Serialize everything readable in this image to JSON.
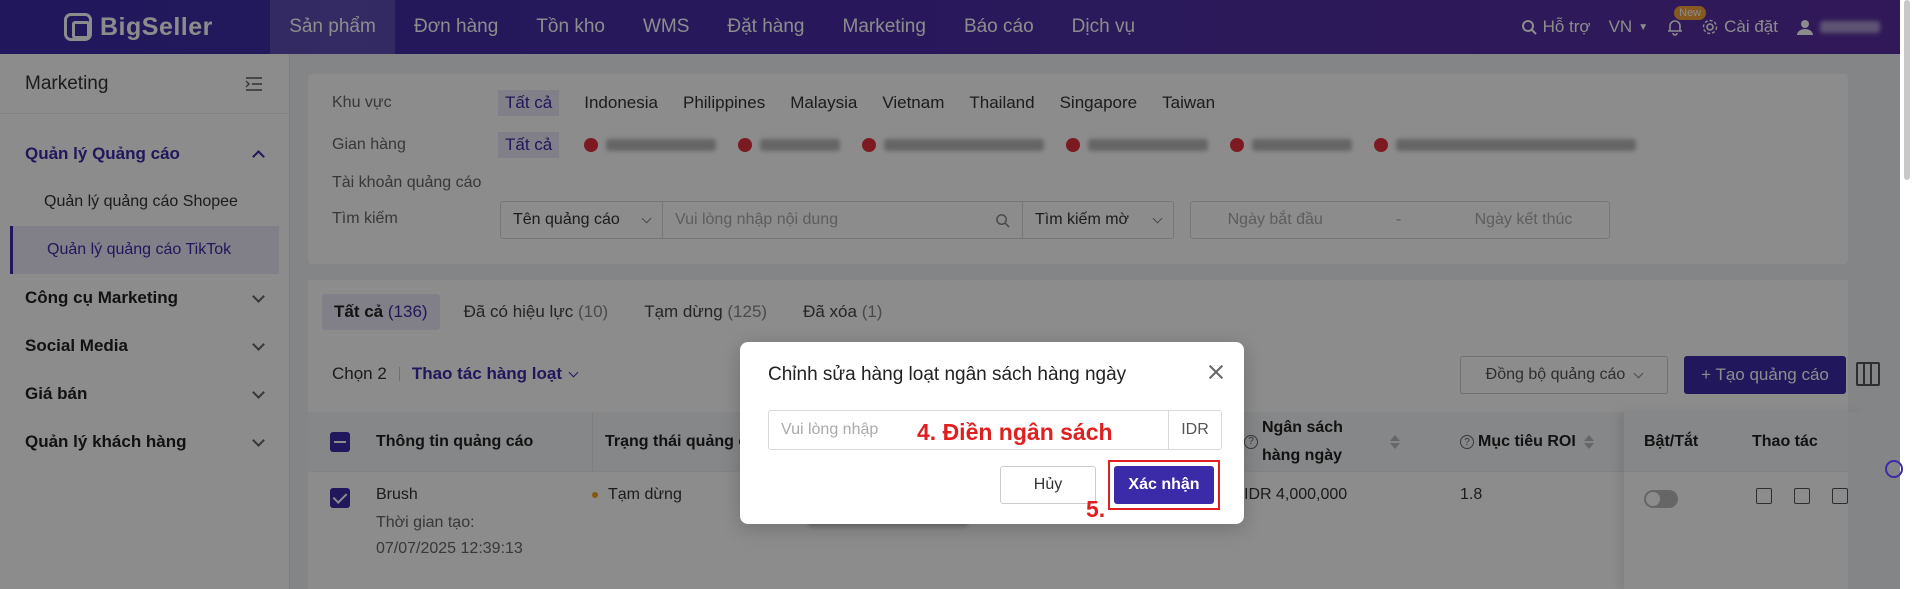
{
  "topnav": {
    "brand": "BigSeller",
    "items": [
      "Sản phẩm",
      "Đơn hàng",
      "Tồn kho",
      "WMS",
      "Đặt hàng",
      "Marketing",
      "Báo cáo",
      "Dịch vụ"
    ],
    "support": "Hỗ trợ",
    "lang": "VN",
    "new_badge": "New",
    "settings": "Cài đặt"
  },
  "sidebar": {
    "title": "Marketing",
    "groups": [
      {
        "label": "Quản lý Quảng cáo",
        "sub": [
          "Quản lý quảng cáo Shopee",
          "Quản lý quảng cáo TikTok"
        ]
      },
      {
        "label": "Công cụ Marketing"
      },
      {
        "label": "Social Media"
      },
      {
        "label": "Giá bán"
      },
      {
        "label": "Quản lý khách hàng"
      }
    ]
  },
  "filters": {
    "region_label": "Khu vực",
    "regions": [
      "Tất cả",
      "Indonesia",
      "Philippines",
      "Malaysia",
      "Vietnam",
      "Thailand",
      "Singapore",
      "Taiwan"
    ],
    "shop_label": "Gian hàng",
    "shop_all": "Tất cả",
    "account_label": "Tài khoản quảng cáo",
    "search_label": "Tìm kiếm",
    "search_field": "Tên quảng cáo",
    "search_placeholder": "Vui lòng nhập nội dung",
    "search_mode": "Tìm kiếm mờ",
    "date_start": "Ngày bắt đầu",
    "date_sep": "-",
    "date_end": "Ngày kết thúc"
  },
  "tabs": [
    {
      "label": "Tất cả",
      "count": "(136)"
    },
    {
      "label": "Đã có hiệu lực",
      "count": "(10)"
    },
    {
      "label": "Tạm dừng",
      "count": "(125)"
    },
    {
      "label": "Đã xóa",
      "count": "(1)"
    }
  ],
  "toolbar": {
    "selected": "Chọn 2",
    "bulk": "Thao tác hàng loạt",
    "sync": "Đồng bộ quảng cáo",
    "create": "+ Tạo quảng cáo"
  },
  "table": {
    "headers": {
      "info": "Thông tin quảng cáo",
      "status": "Trạng thái quảng cáo",
      "budget": "Ngân sách hàng ngày",
      "roi": "Mục tiêu ROI",
      "toggle": "Bật/Tắt",
      "actions": "Thao tác"
    },
    "rows": [
      {
        "name": "Brush",
        "created_label": "Thời gian tạo:",
        "created": "07/07/2025 12:39:13",
        "status": "Tạm dừng",
        "budget": "IDR 4,000,000",
        "roi": "1.8"
      }
    ]
  },
  "modal": {
    "title": "Chỉnh sửa hàng loạt ngân sách hàng ngày",
    "placeholder": "Vui lòng nhập",
    "unit": "IDR",
    "cancel": "Hủy",
    "confirm": "Xác nhận",
    "annotation_4": "4. Điền ngân sách",
    "annotation_5": "5."
  },
  "colors": {
    "primary": "#3b2ba8",
    "annotation": "#e02020"
  }
}
